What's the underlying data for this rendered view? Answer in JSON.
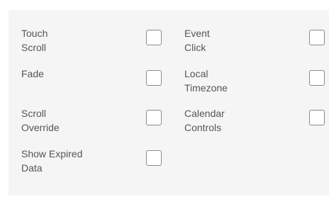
{
  "options": [
    {
      "label": "Touch Scroll",
      "checked": false
    },
    {
      "label": "Event Click",
      "checked": false
    },
    {
      "label": "Fade",
      "checked": false
    },
    {
      "label": "Local Timezone",
      "checked": false
    },
    {
      "label": "Scroll Override",
      "checked": false
    },
    {
      "label": "Calendar Controls",
      "checked": false
    },
    {
      "label": "Show Expired\nData",
      "checked": false
    }
  ]
}
